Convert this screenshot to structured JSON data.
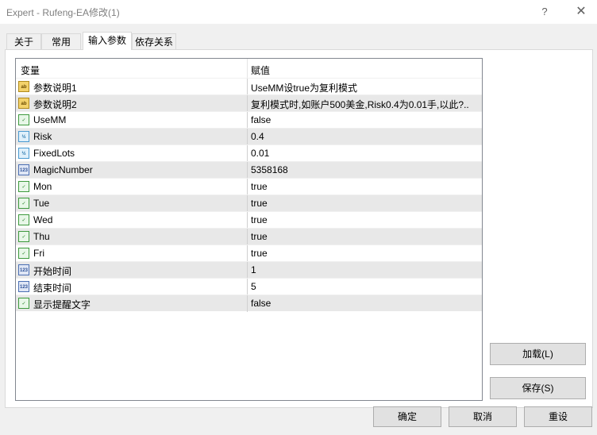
{
  "window": {
    "title": "Expert - Rufeng-EA修改(1)",
    "help_glyph": "?",
    "close_glyph": "✕"
  },
  "tabs": [
    {
      "label": "关于"
    },
    {
      "label": "常用"
    },
    {
      "label": "输入参数",
      "active": true
    },
    {
      "label": "依存关系"
    }
  ],
  "grid": {
    "columns": [
      "变量",
      "赋值"
    ],
    "rows": [
      {
        "icon": "string-icon",
        "name": "参数说明1",
        "value": "UseMM设true为复利模式"
      },
      {
        "icon": "string-icon",
        "name": "参数说明2",
        "value": "复利模式时,如账户500美金,Risk0.4为0.01手,以此?.."
      },
      {
        "icon": "bool-icon",
        "name": "UseMM",
        "value": "false"
      },
      {
        "icon": "double-icon",
        "name": "Risk",
        "value": "0.4"
      },
      {
        "icon": "double-icon",
        "name": "FixedLots",
        "value": "0.01"
      },
      {
        "icon": "int-icon",
        "name": "MagicNumber",
        "value": "5358168"
      },
      {
        "icon": "bool-icon",
        "name": "Mon",
        "value": "true"
      },
      {
        "icon": "bool-icon",
        "name": "Tue",
        "value": "true"
      },
      {
        "icon": "bool-icon",
        "name": "Wed",
        "value": "true"
      },
      {
        "icon": "bool-icon",
        "name": "Thu",
        "value": "true"
      },
      {
        "icon": "bool-icon",
        "name": "Fri",
        "value": "true"
      },
      {
        "icon": "int-icon",
        "name": "开始时间",
        "value": "1"
      },
      {
        "icon": "int-icon",
        "name": "结束时间",
        "value": "5"
      },
      {
        "icon": "bool-icon",
        "name": "显示提醒文字",
        "value": "false"
      }
    ]
  },
  "buttons": {
    "load": "加载(L)",
    "save": "保存(S)",
    "ok": "确定",
    "cancel": "取消",
    "reset": "重设"
  }
}
